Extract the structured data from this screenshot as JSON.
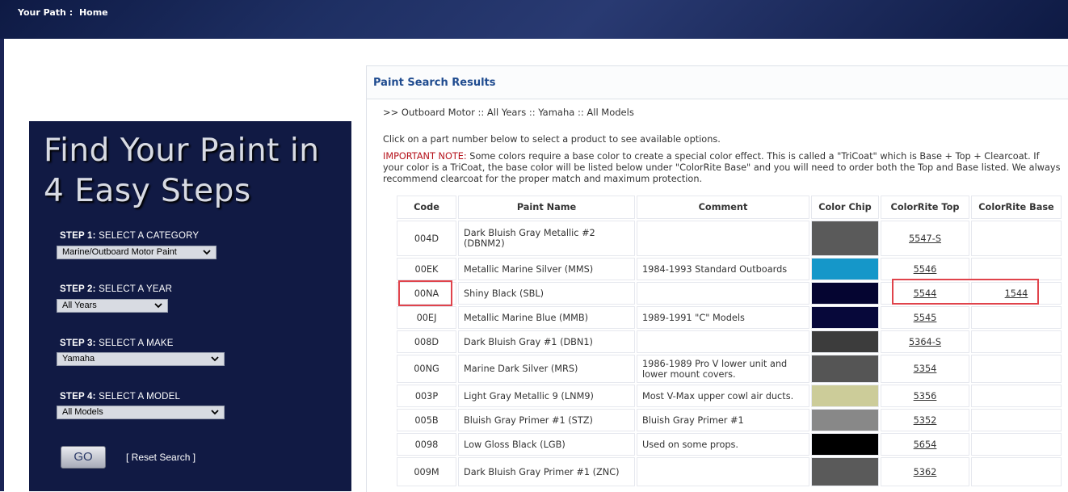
{
  "breadcrumb": {
    "label": "Your Path :",
    "home": "Home"
  },
  "steps": {
    "heading_line1": "Find Your Paint in",
    "heading_line2": "4 Easy Steps",
    "step1": {
      "prefix": "STEP 1:",
      "label": "SELECT A CATEGORY",
      "value": "Marine/Outboard Motor Paint"
    },
    "step2": {
      "prefix": "STEP 2:",
      "label": "SELECT A YEAR",
      "value": "All Years"
    },
    "step3": {
      "prefix": "STEP 3:",
      "label": "SELECT A MAKE",
      "value": "Yamaha"
    },
    "step4": {
      "prefix": "STEP 4:",
      "label": "SELECT A MODEL",
      "value": "All Models"
    },
    "go_label": "GO",
    "reset_label": "[ Reset Search ]"
  },
  "results": {
    "title": "Paint Search Results",
    "path": ">> Outboard Motor :: All Years :: Yamaha :: All Models",
    "instructions": "Click on a part number below to select a product to see available options.",
    "note_label": "IMPORTANT NOTE:",
    "note_text": " Some colors require a base color to create a special color effect. This is called a \"TriCoat\" which is Base + Top + Clearcoat. If your color is a TriCoat, the base color will be listed below under \"ColorRite Base\" and you will need to order both the Top and Base listed. We always recommend clearcoat for the proper match and maximum protection.",
    "columns": [
      "Code",
      "Paint Name",
      "Comment",
      "Color Chip",
      "ColorRite Top",
      "ColorRite Base"
    ],
    "rows": [
      {
        "code": "004D",
        "name": "Dark Bluish Gray Metallic #2 (DBNM2)",
        "comment": "",
        "chip": "#5a5a5a",
        "top": "5547-S",
        "base": ""
      },
      {
        "code": "00EK",
        "name": "Metallic Marine Silver (MMS)",
        "comment": "1984-1993 Standard Outboards",
        "chip": "#1597c9",
        "top": "5546",
        "base": ""
      },
      {
        "code": "00NA",
        "name": "Shiny Black (SBL)",
        "comment": "",
        "chip": "#050531",
        "top": "5544",
        "base": "1544"
      },
      {
        "code": "00EJ",
        "name": "Metallic Marine Blue (MMB)",
        "comment": "1989-1991 \"C\" Models",
        "chip": "#07083a",
        "top": "5545",
        "base": ""
      },
      {
        "code": "008D",
        "name": "Dark Bluish Gray #1 (DBN1)",
        "comment": "",
        "chip": "#3c3c3c",
        "top": "5364-S",
        "base": ""
      },
      {
        "code": "00NG",
        "name": "Marine Dark Silver (MRS)",
        "comment": "1986-1989 Pro V lower unit and lower mount covers.",
        "chip": "#555555",
        "top": "5354",
        "base": ""
      },
      {
        "code": "003P",
        "name": "Light Gray Metallic 9 (LNM9)",
        "comment": "Most V-Max upper cowl air ducts.",
        "chip": "#cccc99",
        "top": "5356",
        "base": ""
      },
      {
        "code": "005B",
        "name": "Bluish Gray Primer #1 (STZ)",
        "comment": "Bluish Gray Primer #1",
        "chip": "#888888",
        "top": "5352",
        "base": ""
      },
      {
        "code": "0098",
        "name": "Low Gloss Black (LGB)",
        "comment": "Used on some props.",
        "chip": "#000000",
        "top": "5654",
        "base": ""
      },
      {
        "code": "009M",
        "name": "Dark Bluish Gray Primer #1 (ZNC)",
        "comment": "",
        "chip": "#5a5a5a",
        "top": "5362",
        "base": ""
      }
    ]
  }
}
